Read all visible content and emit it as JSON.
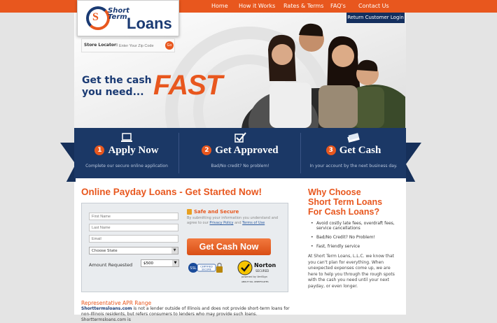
{
  "nav": {
    "items": [
      "Home",
      "How it Works",
      "Rates & Terms",
      "FAQ's",
      "Contact Us"
    ]
  },
  "logo": {
    "mark": "S",
    "line1": "Short",
    "line2": "Term",
    "word": "Loans"
  },
  "header": {
    "return_login": "Return Customer Login"
  },
  "store_locator": {
    "label": "Store Locator:",
    "placeholder": "Enter Your Zip Code",
    "go": "Go"
  },
  "hero": {
    "headline_1": "Get the cash",
    "headline_2": "you need...",
    "fast": "FAST"
  },
  "steps": [
    {
      "num": "1",
      "title": "Apply Now",
      "sub": "Complete our secure online application",
      "icon": "laptop-icon"
    },
    {
      "num": "2",
      "title": "Get Approved",
      "sub": "Bad/No credit? No problem!",
      "icon": "checkbox-icon"
    },
    {
      "num": "3",
      "title": "Get Cash",
      "sub": "In your account by the next business day.",
      "icon": "cash-icon"
    }
  ],
  "form": {
    "heading": "Online Payday Loans - Get Started Now!",
    "first_name": "First Name",
    "last_name": "Last Name",
    "email": "Email",
    "state": "Choose State",
    "amount_label": "Amount Requested",
    "amount": "$500",
    "safe_title": "Safe and Secure",
    "safe_text": "By submitting your information you understand and agree to our",
    "privacy": "Privacy Policy",
    "and": "and",
    "terms": "Terms of Use",
    "submit": "Get Cash Now",
    "ssl_1": "SSL",
    "ssl_2": "CERTIFIED",
    "ssl_3": "SECURE",
    "norton_1": "Norton",
    "norton_2": "SECURED",
    "norton_3": "powered by VeriSign",
    "norton_4": "ABOUT SSL CERTIFICATES"
  },
  "why": {
    "title_1": "Why Choose",
    "title_2": "Short Term Loans",
    "title_3": "For Cash Loans?",
    "bullets": [
      "Avoid costly late fees, overdraft fees, service cancellations",
      "Bad/No Credit? No Problem!",
      "Fast, friendly service"
    ],
    "para": "At Short Term Loans, L.L.C. we know that you can't plan for everything. When unexpected expenses come up, we are here to help you through the rough spots with the cash you need until your next payday, or even longer."
  },
  "apr": {
    "title": "Representative APR Range",
    "brand": "Shorttermsloans.com",
    "text": " is not a lender outside of Illinois and does not provide short-term loans for non-Illinois residents, but refers consumers to lenders who may provide such loans. Shorttermsloans.com is"
  },
  "colors": {
    "accent": "#e8571e",
    "navy": "#1b3866"
  }
}
